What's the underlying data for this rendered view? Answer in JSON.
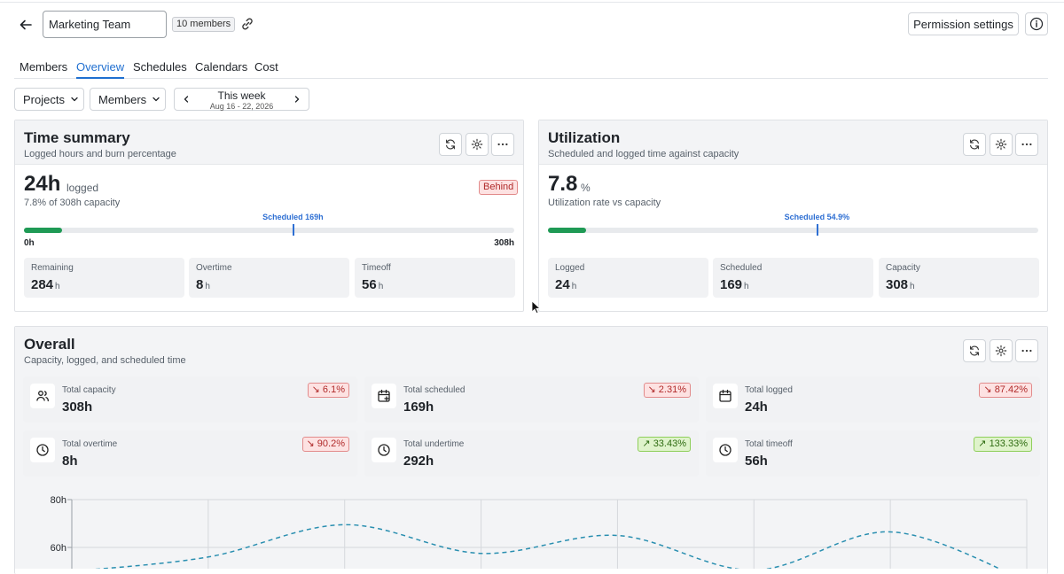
{
  "header": {
    "team_name": "Marketing Team",
    "members_badge": "10 members",
    "permission_button": "Permission settings"
  },
  "tabs": [
    {
      "label": "Members"
    },
    {
      "label": "Overview",
      "active": true
    },
    {
      "label": "Schedules"
    },
    {
      "label": "Calendars"
    },
    {
      "label": "Cost"
    }
  ],
  "filters": {
    "projects": "Projects",
    "members": "Members",
    "week_title": "This week",
    "week_dates": "Aug 16 - 22, 2026"
  },
  "time_summary": {
    "title": "Time summary",
    "subtitle": "Logged hours and burn percentage",
    "value": "24h",
    "value_suffix": "logged",
    "capacity_line": "7.8% of 308h capacity",
    "status_badge": "Behind",
    "marker_label": "Scheduled 169h",
    "axis_min": "0h",
    "axis_max": "308h",
    "fill_fraction": 0.078,
    "marker_fraction": 0.549,
    "stats": [
      {
        "label": "Remaining",
        "value": "284",
        "unit": "h"
      },
      {
        "label": "Overtime",
        "value": "8",
        "unit": "h"
      },
      {
        "label": "Timeoff",
        "value": "56",
        "unit": "h"
      }
    ]
  },
  "utilization": {
    "title": "Utilization",
    "subtitle": "Scheduled and logged time against capacity",
    "value": "7.8",
    "value_suffix": "%",
    "rate_line": "Utilization rate vs capacity",
    "marker_label": "Scheduled 54.9%",
    "fill_fraction": 0.078,
    "marker_fraction": 0.549,
    "stats": [
      {
        "label": "Logged",
        "value": "24",
        "unit": "h"
      },
      {
        "label": "Scheduled",
        "value": "169",
        "unit": "h"
      },
      {
        "label": "Capacity",
        "value": "308",
        "unit": "h"
      }
    ]
  },
  "overall": {
    "title": "Overall",
    "subtitle": "Capacity, logged, and scheduled time",
    "metrics": [
      {
        "label": "Total capacity",
        "value": "308h",
        "trend": "6.1%",
        "direction": "down",
        "icon": "users-icon"
      },
      {
        "label": "Total scheduled",
        "value": "169h",
        "trend": "2.31%",
        "direction": "down",
        "icon": "calendar-plus-icon"
      },
      {
        "label": "Total logged",
        "value": "24h",
        "trend": "87.42%",
        "direction": "down",
        "icon": "calendar-icon"
      },
      {
        "label": "Total overtime",
        "value": "8h",
        "trend": "90.2%",
        "direction": "down",
        "icon": "clock-icon"
      },
      {
        "label": "Total undertime",
        "value": "292h",
        "trend": "33.43%",
        "direction": "up",
        "icon": "clock-icon"
      },
      {
        "label": "Total timeoff",
        "value": "56h",
        "trend": "133.33%",
        "direction": "up",
        "icon": "clock-icon"
      }
    ]
  },
  "chart_data": {
    "type": "line",
    "y_ticks": [
      "80h",
      "60h"
    ],
    "ylim": [
      0,
      80
    ],
    "x": [
      0,
      1,
      2,
      3,
      4,
      5,
      6,
      7
    ],
    "series": [
      {
        "values": [
          50,
          56,
          69.5,
          57.5,
          65,
          50.5,
          66.5,
          46
        ],
        "color": "#2a8fb0",
        "style": "dashed"
      }
    ],
    "grid": true
  },
  "colors": {
    "accent": "#1f6fd0",
    "progress": "#1f9a55",
    "marker": "#2e6fd3",
    "down": "#b02a2a",
    "up": "#2e6b11"
  }
}
